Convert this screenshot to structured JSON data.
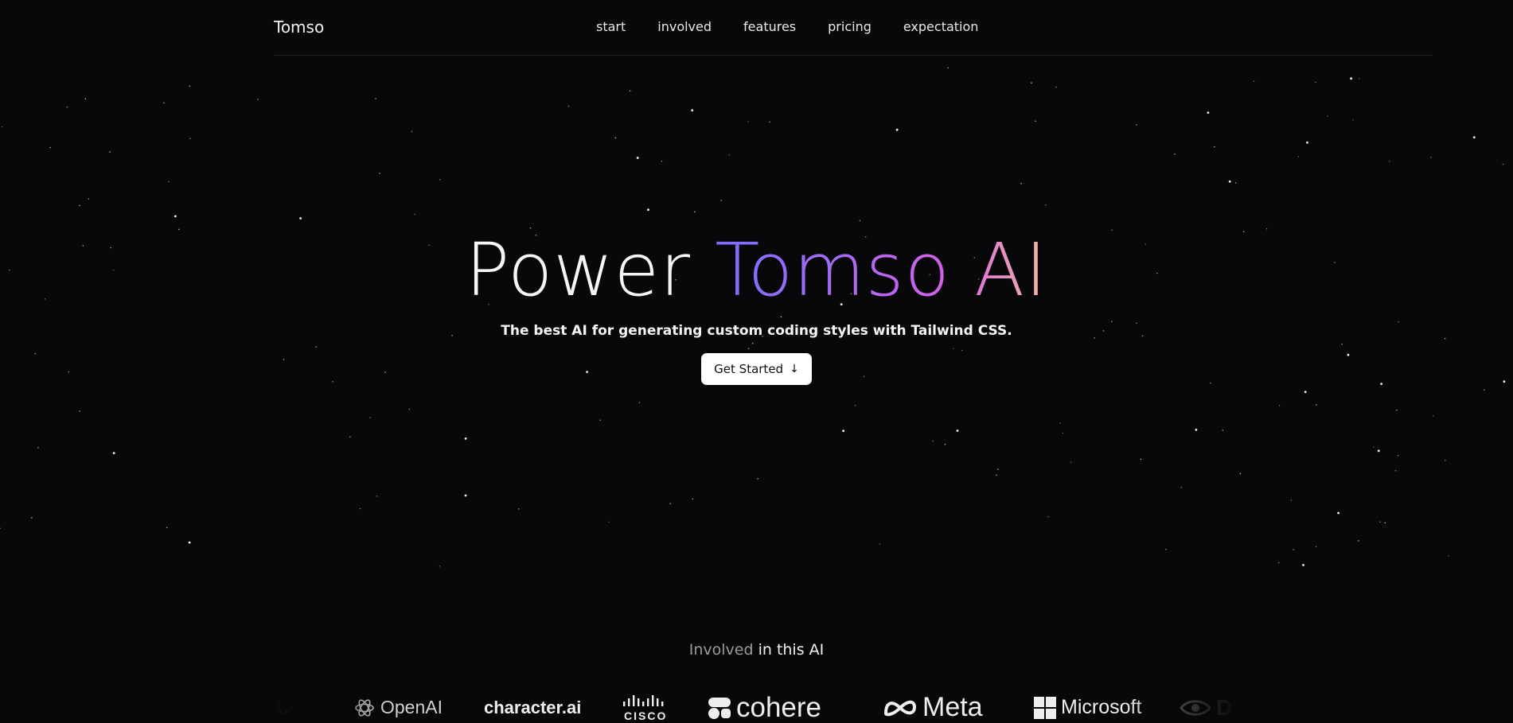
{
  "nav": {
    "brand": "Tomso",
    "links": [
      "start",
      "involved",
      "features",
      "pricing",
      "expectation"
    ]
  },
  "hero": {
    "title_plain": "Power",
    "title_gradient": "Tomso AI",
    "subtitle": "The best AI for generating custom coding styles with Tailwind CSS.",
    "cta_label": "Get Started",
    "cta_icon": "arrow-down-icon"
  },
  "involved": {
    "muted": "Involved",
    "strong": "in this AI"
  },
  "logos": {
    "partial_left": "IA.",
    "openai": "OpenAI",
    "character": "character.ai",
    "cisco": "CISCO",
    "cohere": "cohere",
    "meta": "Meta",
    "microsoft": "Microsoft",
    "partial_right": "D"
  },
  "colors": {
    "background": "#08080a",
    "gradient_start": "#7b6dff",
    "gradient_mid": "#d45fe6",
    "gradient_end": "#f3b7a4"
  }
}
